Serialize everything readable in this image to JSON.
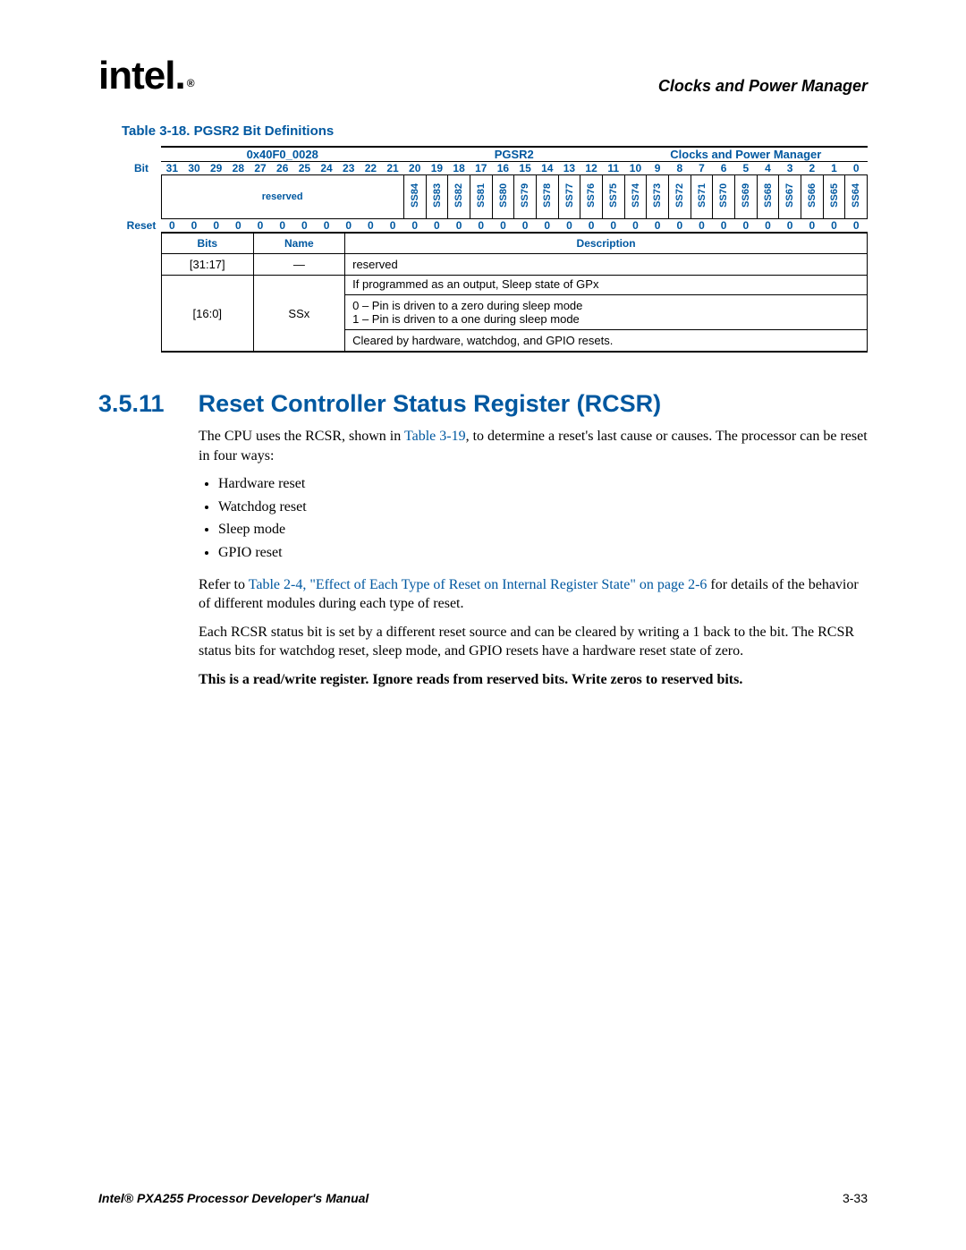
{
  "header": {
    "logo_text": "intel",
    "logo_reg": "®",
    "section_right": "Clocks and Power Manager"
  },
  "table_caption": "Table 3-18. PGSR2 Bit Definitions",
  "reg_header": {
    "address": "0x40F0_0028",
    "name": "PGSR2",
    "owner": "Clocks and Power Manager"
  },
  "labels": {
    "bit": "Bit",
    "reset": "Reset",
    "reserved": "reserved"
  },
  "bit_numbers": [
    "31",
    "30",
    "29",
    "28",
    "27",
    "26",
    "25",
    "24",
    "23",
    "22",
    "21",
    "20",
    "19",
    "18",
    "17",
    "16",
    "15",
    "14",
    "13",
    "12",
    "11",
    "10",
    "9",
    "8",
    "7",
    "6",
    "5",
    "4",
    "3",
    "2",
    "1",
    "0"
  ],
  "ss_labels": [
    "SS84",
    "SS83",
    "SS82",
    "SS81",
    "SS80",
    "SS79",
    "SS78",
    "SS77",
    "SS76",
    "SS75",
    "SS74",
    "SS73",
    "SS72",
    "SS71",
    "SS70",
    "SS69",
    "SS68",
    "SS67",
    "SS66",
    "SS65",
    "SS64"
  ],
  "reset_values": [
    "0",
    "0",
    "0",
    "0",
    "0",
    "0",
    "0",
    "0",
    "0",
    "0",
    "0",
    "0",
    "0",
    "0",
    "0",
    "0",
    "0",
    "0",
    "0",
    "0",
    "0",
    "0",
    "0",
    "0",
    "0",
    "0",
    "0",
    "0",
    "0",
    "0",
    "0",
    "0"
  ],
  "desc_table": {
    "headers": {
      "bits": "Bits",
      "name": "Name",
      "desc": "Description"
    },
    "rows": [
      {
        "bits": "[31:17]",
        "name": "—",
        "desc": "reserved"
      },
      {
        "bits": "[16:0]",
        "name": "SSx",
        "desc_lines": [
          "If programmed as an output, Sleep state of GPx",
          "0 –   Pin is driven to a zero during sleep mode",
          "1 –   Pin is driven to a one during sleep mode",
          "Cleared by hardware, watchdog, and GPIO resets."
        ]
      }
    ]
  },
  "section": {
    "num": "3.5.11",
    "title": "Reset Controller Status Register (RCSR)"
  },
  "body": {
    "p1a": "The CPU uses the RCSR, shown in ",
    "p1_link": "Table 3-19",
    "p1b": ", to determine a reset's last cause or causes. The processor can be reset in four ways:",
    "bullets": [
      "Hardware reset",
      "Watchdog reset",
      "Sleep mode",
      "GPIO reset"
    ],
    "p2a": "Refer to ",
    "p2_link": "Table 2-4, \"Effect of Each Type of Reset on Internal Register State\" on page 2-6",
    "p2b": " for details of the behavior of different modules during each type of reset.",
    "p3": "Each RCSR status bit is set by a different reset source and can be cleared by writing a 1 back to the bit. The RCSR status bits for watchdog reset, sleep mode, and GPIO resets have a hardware reset state of zero.",
    "p4": "This is a read/write register. Ignore reads from reserved bits. Write zeros to reserved bits."
  },
  "footer": {
    "title": "Intel® PXA255 Processor Developer's Manual",
    "page": "3-33"
  }
}
